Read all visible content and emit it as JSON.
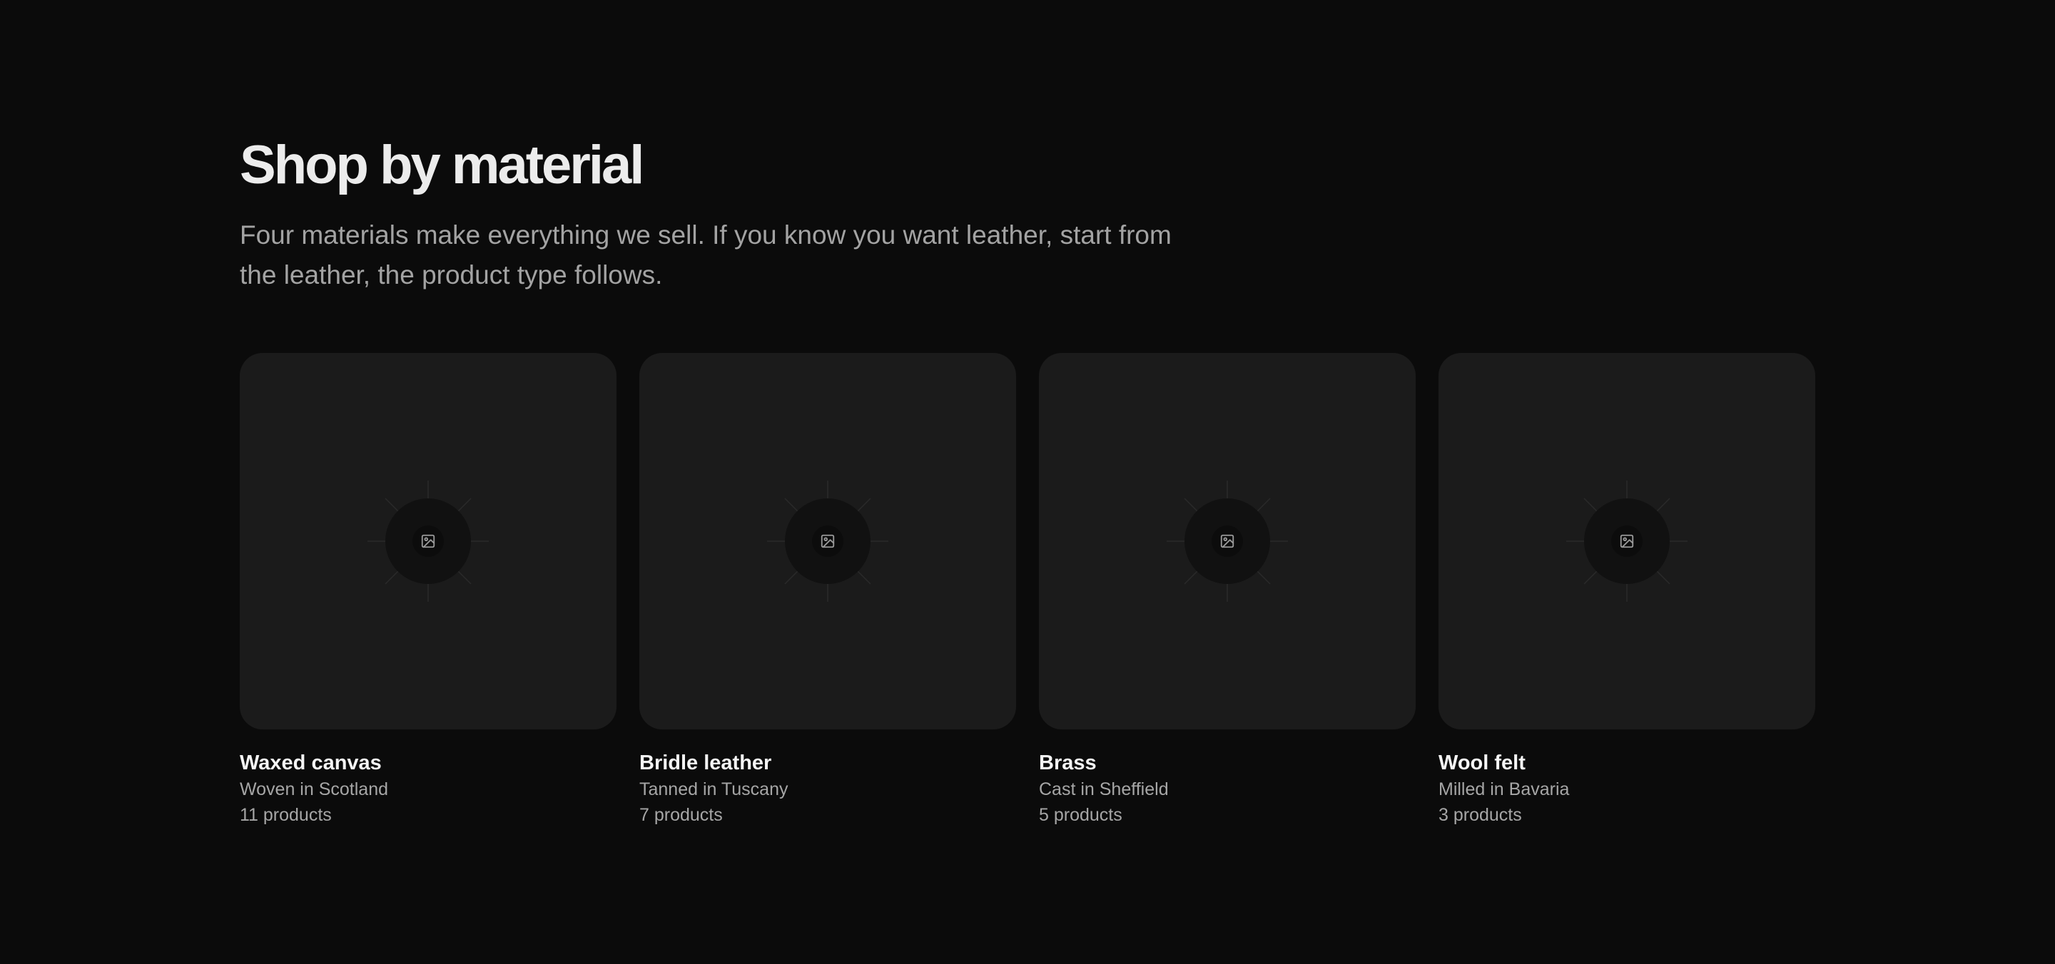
{
  "section": {
    "title": "Shop by material",
    "subtitle": "Four materials make everything we sell. If you know you want leather, start from the leather, the product type follows."
  },
  "materials": [
    {
      "name": "Waxed canvas",
      "origin": "Woven in Scotland",
      "count": "11 products",
      "icon": "image-placeholder-icon"
    },
    {
      "name": "Bridle leather",
      "origin": "Tanned in Tuscany",
      "count": "7 products",
      "icon": "image-placeholder-icon"
    },
    {
      "name": "Brass",
      "origin": "Cast in Sheffield",
      "count": "5 products",
      "icon": "image-placeholder-icon"
    },
    {
      "name": "Wool felt",
      "origin": "Milled in Bavaria",
      "count": "3 products",
      "icon": "image-placeholder-icon"
    }
  ],
  "colors": {
    "background": "#0b0b0b",
    "card": "#1b1b1b",
    "text_primary": "#f5f5f5",
    "text_secondary": "#a6a6a6"
  }
}
